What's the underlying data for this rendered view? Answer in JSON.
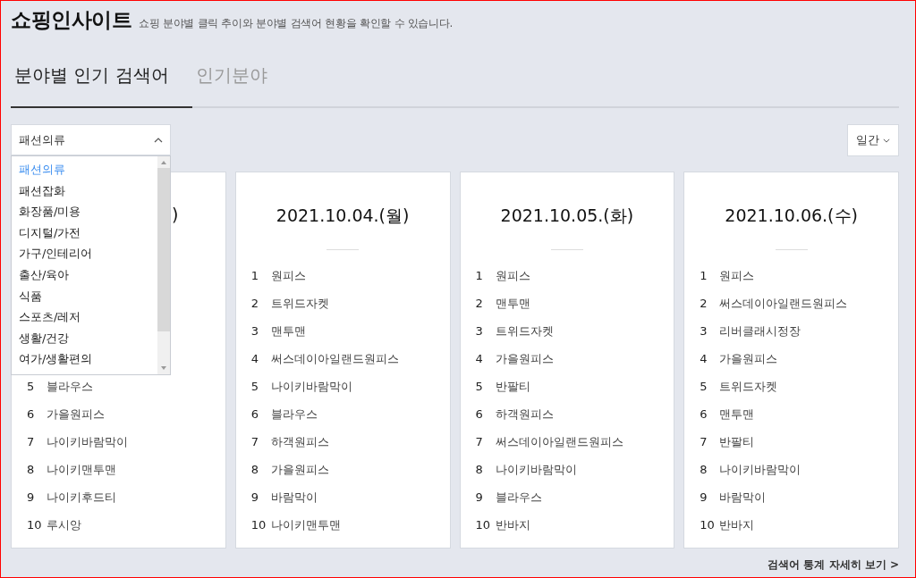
{
  "header": {
    "title": "쇼핑인사이트",
    "description": "쇼핑 분야별 클릭 추이와 분야별 검색어 현황을 확인할 수 있습니다."
  },
  "tabs": [
    {
      "label": "분야별 인기 검색어",
      "selected": true
    },
    {
      "label": "인기분야",
      "selected": false
    }
  ],
  "category_select": {
    "value": "패션의류",
    "expanded": true,
    "options": [
      {
        "label": "패션의류",
        "selected": true
      },
      {
        "label": "패션잡화",
        "selected": false
      },
      {
        "label": "화장품/미용",
        "selected": false
      },
      {
        "label": "디지털/가전",
        "selected": false
      },
      {
        "label": "가구/인테리어",
        "selected": false
      },
      {
        "label": "출산/육아",
        "selected": false
      },
      {
        "label": "식품",
        "selected": false
      },
      {
        "label": "스포츠/레저",
        "selected": false
      },
      {
        "label": "생활/건강",
        "selected": false
      },
      {
        "label": "여가/생활편의",
        "selected": false
      }
    ]
  },
  "period_select": {
    "value": "일간"
  },
  "cards": [
    {
      "title": ")",
      "rows": [
        {
          "rank": "5",
          "keyword": "블라우스"
        },
        {
          "rank": "6",
          "keyword": "가을원피스"
        },
        {
          "rank": "7",
          "keyword": "나이키바람막이"
        },
        {
          "rank": "8",
          "keyword": "나이키맨투맨"
        },
        {
          "rank": "9",
          "keyword": "나이키후드티"
        },
        {
          "rank": "10",
          "keyword": "루시앙"
        }
      ]
    },
    {
      "title": "2021.10.04.(월)",
      "rows": [
        {
          "rank": "1",
          "keyword": "원피스"
        },
        {
          "rank": "2",
          "keyword": "트위드자켓"
        },
        {
          "rank": "3",
          "keyword": "맨투맨"
        },
        {
          "rank": "4",
          "keyword": "써스데이아일랜드원피스"
        },
        {
          "rank": "5",
          "keyword": "나이키바람막이"
        },
        {
          "rank": "6",
          "keyword": "블라우스"
        },
        {
          "rank": "7",
          "keyword": "하객원피스"
        },
        {
          "rank": "8",
          "keyword": "가을원피스"
        },
        {
          "rank": "9",
          "keyword": "바람막이"
        },
        {
          "rank": "10",
          "keyword": "나이키맨투맨"
        }
      ]
    },
    {
      "title": "2021.10.05.(화)",
      "rows": [
        {
          "rank": "1",
          "keyword": "원피스"
        },
        {
          "rank": "2",
          "keyword": "맨투맨"
        },
        {
          "rank": "3",
          "keyword": "트위드자켓"
        },
        {
          "rank": "4",
          "keyword": "가을원피스"
        },
        {
          "rank": "5",
          "keyword": "반팔티"
        },
        {
          "rank": "6",
          "keyword": "하객원피스"
        },
        {
          "rank": "7",
          "keyword": "써스데이아일랜드원피스"
        },
        {
          "rank": "8",
          "keyword": "나이키바람막이"
        },
        {
          "rank": "9",
          "keyword": "블라우스"
        },
        {
          "rank": "10",
          "keyword": "반바지"
        }
      ]
    },
    {
      "title": "2021.10.06.(수)",
      "rows": [
        {
          "rank": "1",
          "keyword": "원피스"
        },
        {
          "rank": "2",
          "keyword": "써스데이아일랜드원피스"
        },
        {
          "rank": "3",
          "keyword": "리버클래시정장"
        },
        {
          "rank": "4",
          "keyword": "가을원피스"
        },
        {
          "rank": "5",
          "keyword": "트위드자켓"
        },
        {
          "rank": "6",
          "keyword": "맨투맨"
        },
        {
          "rank": "7",
          "keyword": "반팔티"
        },
        {
          "rank": "8",
          "keyword": "나이키바람막이"
        },
        {
          "rank": "9",
          "keyword": "바람막이"
        },
        {
          "rank": "10",
          "keyword": "반바지"
        }
      ]
    }
  ],
  "more_link": {
    "label": "검색어 통계 자세히 보기",
    "icon": ">"
  }
}
